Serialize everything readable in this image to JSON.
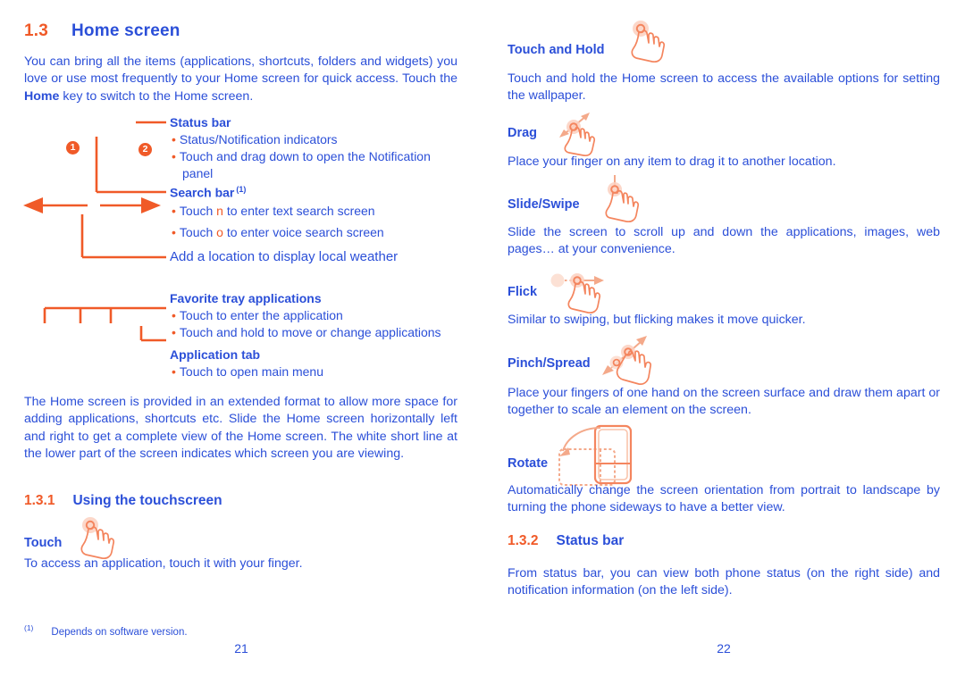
{
  "document": {
    "title": "Home screen",
    "accent_orange": "#f05a28",
    "accent_blue": "#2b4fd8"
  },
  "left_page": {
    "heading": {
      "number": "1.3",
      "title": "Home screen"
    },
    "intro": "You can bring all the items (applications, shortcuts, folders and widgets) you love or use most frequently to your Home screen for quick access. Touch the ",
    "intro_bold": "Home",
    "intro_tail": " key to switch to the Home screen.",
    "badges": [
      "❶",
      "❷"
    ],
    "badge_one": "1",
    "badge_two": "2",
    "callouts": [
      {
        "head": "Status bar",
        "sup": "",
        "lines": [
          "Status/Notification indicators",
          "Touch and drag down to open the Notification",
          "panel"
        ]
      },
      {
        "head": "Search bar",
        "sup": "(1)",
        "line_text_a_pre": "Touch ",
        "line_text_a_sym": "n",
        "line_text_a_post": " to enter text search screen",
        "line_text_b_pre": "Touch ",
        "line_text_b_sym": "o",
        "line_text_b_post": " to enter voice search screen"
      },
      {
        "plain": "Add a location to display local weather"
      },
      {
        "head": "Favorite tray applications",
        "lines": [
          "Touch to enter the application",
          "Touch and hold to move or change applications"
        ]
      },
      {
        "head": "Application tab",
        "lines": [
          "Touch to open main menu"
        ]
      }
    ],
    "body_paragraph": "The Home screen is provided in an extended format to allow more space for adding applications, shortcuts etc. Slide the Home screen horizontally left and right to get a complete view of the Home screen. The white short line at the lower part of the screen indicates which screen you are viewing.",
    "subheading": {
      "number": "1.3.1",
      "title": "Using the touchscreen"
    },
    "touch": {
      "title": "Touch",
      "body": "To access an application, touch it with your finger."
    },
    "footnote": {
      "marker": "(1)",
      "text": "Depends on software version."
    },
    "folio": "21"
  },
  "right_page": {
    "gestures": [
      {
        "title": "Touch and Hold",
        "icon": "hand-tap-icon",
        "body": "Touch and hold the Home screen to access the available options for setting the wallpaper."
      },
      {
        "title": "Drag",
        "icon": "hand-drag-icon",
        "body": "Place your finger on any item to drag it to another location."
      },
      {
        "title": "Slide/Swipe",
        "icon": "hand-slide-icon",
        "body": "Slide the screen to scroll up and down the applications, images, web pages… at your convenience."
      },
      {
        "title": "Flick",
        "icon": "hand-flick-icon",
        "body": "Similar to swiping, but flicking makes it move quicker."
      },
      {
        "title": "Pinch/Spread",
        "icon": "hand-pinch-icon",
        "body": "Place your fingers of one hand on the screen surface and draw them apart or together to scale an element on the screen."
      },
      {
        "title": "Rotate",
        "icon": "phone-rotate-icon",
        "body": "Automatically change the screen orientation from portrait to landscape by turning the phone sideways to have a better view."
      }
    ],
    "subheading": {
      "number": "1.3.2",
      "title": "Status bar"
    },
    "status_bar_body": "From status bar, you can view both phone status (on the right side) and notification information (on the left side).",
    "folio": "22"
  }
}
